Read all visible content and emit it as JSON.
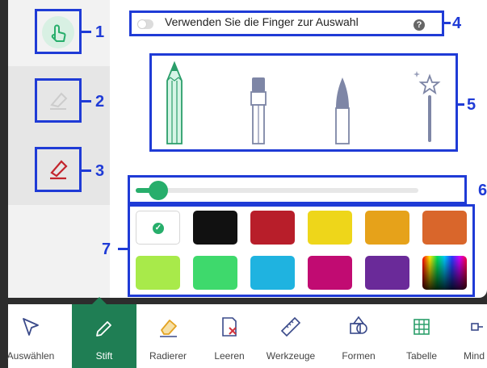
{
  "finger_toggle": {
    "label": "Verwenden Sie die Finger zur Auswahl",
    "help": "?",
    "state": false
  },
  "annotations": [
    "1",
    "2",
    "3",
    "4",
    "5",
    "6",
    "7"
  ],
  "pen_types": [
    {
      "icon": "pencil-icon"
    },
    {
      "icon": "marker-pen-icon"
    },
    {
      "icon": "brush-pen-icon"
    },
    {
      "icon": "magic-wand-icon"
    }
  ],
  "thickness": 0.08,
  "colors": [
    {
      "hex": "#ffffff",
      "selected": true,
      "check": "✓"
    },
    {
      "hex": "#111111"
    },
    {
      "hex": "#b81e2a"
    },
    {
      "hex": "#eed61a"
    },
    {
      "hex": "#e6a21a"
    },
    {
      "hex": "#d9662b"
    },
    {
      "hex": "#a8ea4a"
    },
    {
      "hex": "#3ed96c"
    },
    {
      "hex": "#1fb3e0"
    },
    {
      "hex": "#c10b72"
    },
    {
      "hex": "#6a2a99"
    },
    {
      "hex": "rainbow"
    }
  ],
  "toolbar": [
    {
      "label": "Auswählen",
      "icon": "cursor-icon"
    },
    {
      "label": "Stift",
      "icon": "pen-icon",
      "active": true
    },
    {
      "label": "Radierer",
      "icon": "eraser-icon"
    },
    {
      "label": "Leeren",
      "icon": "clear-icon"
    },
    {
      "label": "Werkzeuge",
      "icon": "ruler-icon"
    },
    {
      "label": "Formen",
      "icon": "shapes-icon"
    },
    {
      "label": "Tabelle",
      "icon": "table-icon"
    },
    {
      "label": "Mind",
      "icon": "mindmap-icon"
    }
  ],
  "accent": "#27ae6b",
  "highlight": "#1f3bd6"
}
